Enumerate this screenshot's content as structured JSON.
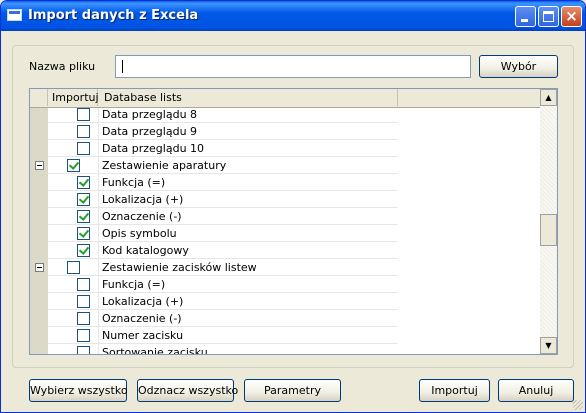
{
  "window": {
    "title": "Import danych z Excela"
  },
  "file": {
    "label": "Nazwa pliku",
    "value": "",
    "browse_label": "Wybór"
  },
  "grid": {
    "columns": [
      "Importuj",
      "Database lists"
    ],
    "rows": [
      {
        "label": "Data przeglądu 8",
        "checked": false,
        "level": 1
      },
      {
        "label": "Data przeglądu 9",
        "checked": false,
        "level": 1
      },
      {
        "label": "Data przeglądu 10",
        "checked": false,
        "level": 1
      },
      {
        "label": "Zestawienie aparatury",
        "checked": true,
        "level": 0,
        "expanded": true
      },
      {
        "label": "Funkcja (=)",
        "checked": true,
        "level": 1
      },
      {
        "label": "Lokalizacja (+)",
        "checked": true,
        "level": 1
      },
      {
        "label": "Oznaczenie (-)",
        "checked": true,
        "level": 1
      },
      {
        "label": "Opis symbolu",
        "checked": true,
        "level": 1
      },
      {
        "label": "Kod katalogowy",
        "checked": true,
        "level": 1
      },
      {
        "label": "Zestawienie zacisków listew",
        "checked": false,
        "level": 0,
        "expanded": true
      },
      {
        "label": "Funkcja (=)",
        "checked": false,
        "level": 1
      },
      {
        "label": "Lokalizacja (+)",
        "checked": false,
        "level": 1
      },
      {
        "label": "Oznaczenie (-)",
        "checked": false,
        "level": 1
      },
      {
        "label": "Numer zacisku",
        "checked": false,
        "level": 1
      },
      {
        "label": "Sortowanie zacisku",
        "checked": false,
        "level": 1
      }
    ]
  },
  "buttons": {
    "select_all": "Wybierz wszystko",
    "deselect_all": "Odznacz wszystko",
    "parameters": "Parametry",
    "import": "Importuj",
    "cancel": "Anuluj"
  },
  "icons": {
    "app": "window-icon",
    "minimize": "minimize-icon",
    "maximize": "maximize-icon",
    "close": "close-icon",
    "scroll_up": "arrow-up-icon",
    "scroll_down": "arrow-down-icon"
  }
}
